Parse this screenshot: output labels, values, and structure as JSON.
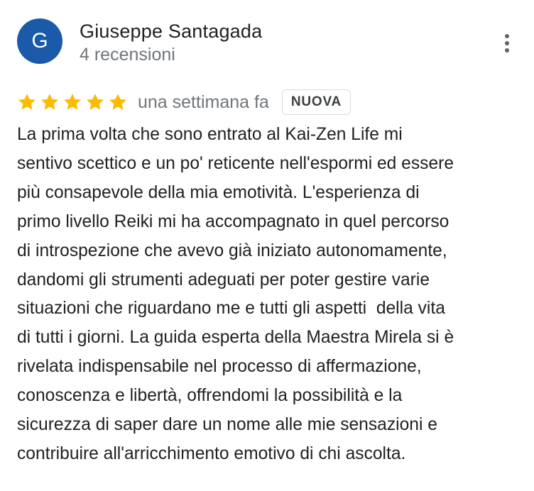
{
  "author": {
    "initial": "G",
    "name": "Giuseppe Santagada",
    "meta": "4 recensioni",
    "avatar_color": "#1a5aa8"
  },
  "menu": {
    "icon": "more-vert-icon"
  },
  "rating": {
    "stars": 5,
    "max_stars": 5,
    "star_color": "#fbbc04",
    "time_ago": "una settimana fa",
    "badge": "NUOVA"
  },
  "review": {
    "lines": [
      "La prima volta che sono entrato al Kai-Zen Life mi",
      "sentivo scettico e un po' reticente nell'espormi ed essere",
      "più consapevole della mia emotività. L'esperienza di",
      "primo livello Reiki mi ha accompagnato in quel percorso",
      "di introspezione che avevo già iniziato autonomamente,",
      "dandomi gli strumenti adeguati per poter gestire varie",
      "situazioni che riguardano me e tutti gli aspetti  della vita",
      "di tutti i giorni. La guida esperta della Maestra Mirela si è",
      "rivelata indispensabile nel processo di affermazione,",
      "conoscenza e libertà, offrendomi la possibilità e la",
      "sicurezza di saper dare un nome alle mie sensazioni e",
      "contribuire all'arricchimento emotivo di chi ascolta."
    ]
  }
}
